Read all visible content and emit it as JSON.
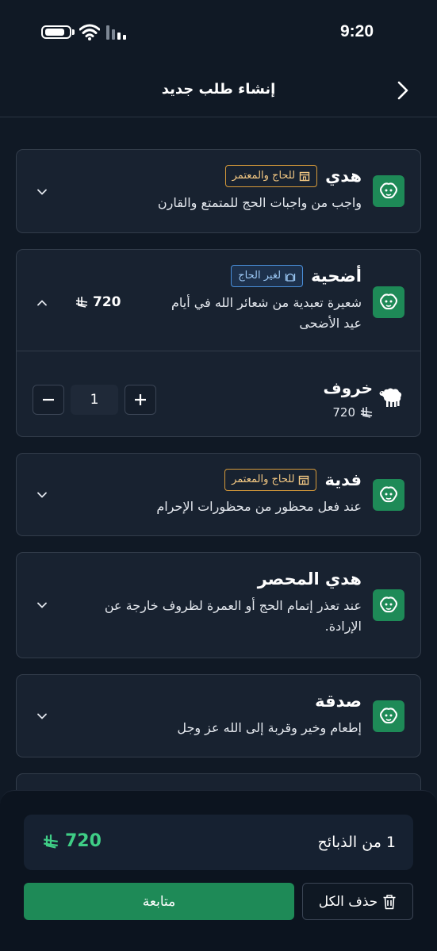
{
  "status_bar": {
    "time": "9:20"
  },
  "header": {
    "title": "إنشاء طلب جديد"
  },
  "cards": [
    {
      "title": "هدي",
      "badge": "للحاج والمعتمر",
      "description": "واجب من واجبات الحج للمتمتع والقارن"
    },
    {
      "title": "أضحية",
      "badge": "لغير الحاج",
      "description_line1": "شعيرة تعبدية من شعائر الله في أيام",
      "description_line2": "عيد الأضحى",
      "price": "720",
      "animal": {
        "name": "خروف",
        "price": "720",
        "quantity": "1"
      }
    },
    {
      "title": "فدية",
      "badge": "للحاج والمعتمر",
      "description": "عند فعل محظور من محظورات الإحرام"
    },
    {
      "title": "هدي المحصر",
      "description_line1": "عند تعذر إتمام الحج أو العمرة لظروف خارجة عن",
      "description_line2": "الإرادة."
    },
    {
      "title": "صدقة",
      "description": "إطعام وخير وقربة إلى الله عز وجل"
    }
  ],
  "summary": {
    "label": "1 من الذبائح",
    "total": "720"
  },
  "actions": {
    "continue_label": "متابعة",
    "delete_all_label": "حذف الكل"
  },
  "colors": {
    "accent": "#1e8a57",
    "total_text": "#3fce86",
    "badge_gold": "#d69a3a",
    "badge_blue": "#4a8fd9"
  },
  "icons": {
    "card_icon": "sacrificial-animal-icon",
    "currency": "saudi-riyal-icon",
    "badge_hajj": "kaaba-icon",
    "badge_non_hajj": "mosque-icon",
    "animal": "sheep-icon"
  }
}
